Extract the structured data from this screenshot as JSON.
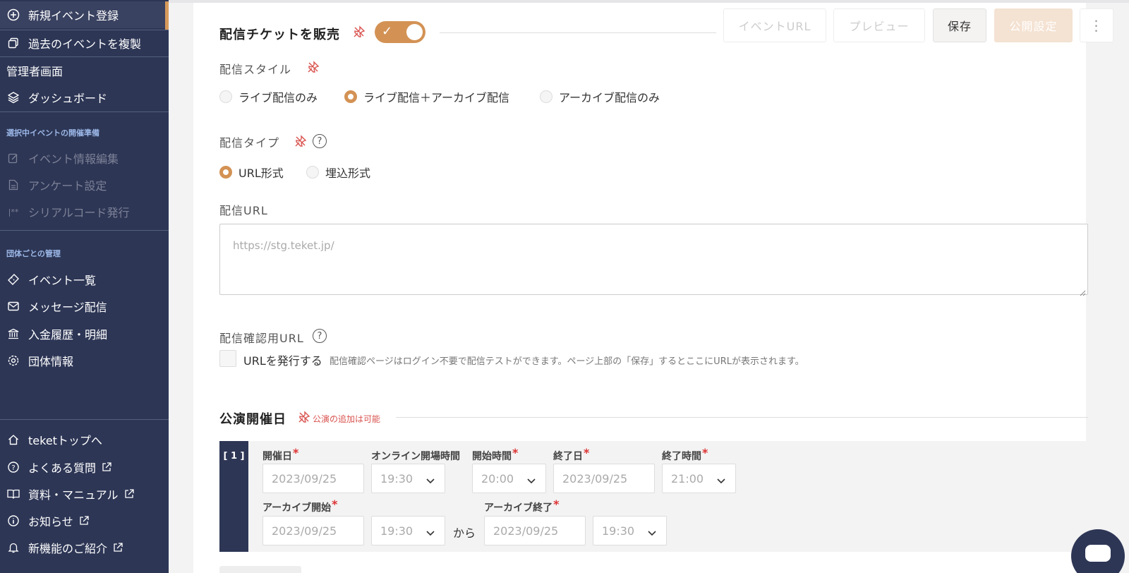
{
  "sidebar": {
    "top_items": [
      {
        "label": "新規イベント登録",
        "icon": "plus-circle-icon"
      },
      {
        "label": "過去のイベントを複製",
        "icon": "copy-icon"
      }
    ],
    "admin_label": "管理者画面",
    "dashboard_label": "ダッシュボード",
    "section_event_prep": "選択中イベントの開催準備",
    "prep_items": [
      {
        "label": "イベント情報編集",
        "icon": "edit-icon"
      },
      {
        "label": "アンケート設定",
        "icon": "document-icon"
      },
      {
        "label": "シリアルコード発行",
        "icon": "serial-code-icon"
      }
    ],
    "section_org": "団体ごとの管理",
    "org_items": [
      {
        "label": "イベント一覧",
        "icon": "ticket-icon"
      },
      {
        "label": "メッセージ配信",
        "icon": "mail-icon"
      },
      {
        "label": "入金履歴・明細",
        "icon": "bank-icon"
      },
      {
        "label": "団体情報",
        "icon": "gear-icon"
      }
    ],
    "bottom_items": [
      {
        "label": "teketトップへ",
        "icon": "home-icon"
      },
      {
        "label": "よくある質問",
        "icon": "question-icon"
      },
      {
        "label": "資料・マニュアル",
        "icon": "book-icon"
      },
      {
        "label": "お知らせ",
        "icon": "info-icon"
      },
      {
        "label": "新機能のご紹介",
        "icon": "bell-icon"
      }
    ]
  },
  "header": {
    "sell_ticket_label": "配信チケットを販売",
    "event_url_button": "イベントURL",
    "preview_button": "プレビュー",
    "save_button": "保存",
    "publish_button": "公開設定"
  },
  "style": {
    "label": "配信スタイル",
    "options": [
      "ライブ配信のみ",
      "ライブ配信＋アーカイブ配信",
      "アーカイブ配信のみ"
    ],
    "selected": 1
  },
  "type": {
    "label": "配信タイプ",
    "options": [
      "URL形式",
      "埋込形式"
    ],
    "selected": 0
  },
  "stream_url": {
    "label": "配信URL",
    "placeholder": "https://stg.teket.jp/"
  },
  "check_url": {
    "label": "配信確認用URL",
    "checkbox_label": "URLを発行する",
    "note": "配信確認ページはログイン不要で配信テストができます。ページ上部の「保存」するとここにURLが表示されます。"
  },
  "performance": {
    "title": "公演開催日",
    "note": "公演の追加は可能",
    "index": "[ 1 ]",
    "labels": {
      "date": "開催日",
      "open_time": "オンライン開場時間",
      "start_time": "開始時間",
      "end_date": "終了日",
      "end_time": "終了時間",
      "archive_start": "アーカイブ開始",
      "archive_end": "アーカイブ終了",
      "from": "から"
    },
    "values": {
      "date": "2023/09/25",
      "open_time": "19:30",
      "start_time": "20:00",
      "end_date": "2023/09/25",
      "end_time": "21:00",
      "archive_start_date": "2023/09/25",
      "archive_start_time": "19:30",
      "archive_end_date": "2023/09/25",
      "archive_end_time": "19:30"
    }
  },
  "colors": {
    "sidebar_bg": "#2d3655",
    "accent": "#d39254",
    "pin_red": "#d9534f"
  }
}
